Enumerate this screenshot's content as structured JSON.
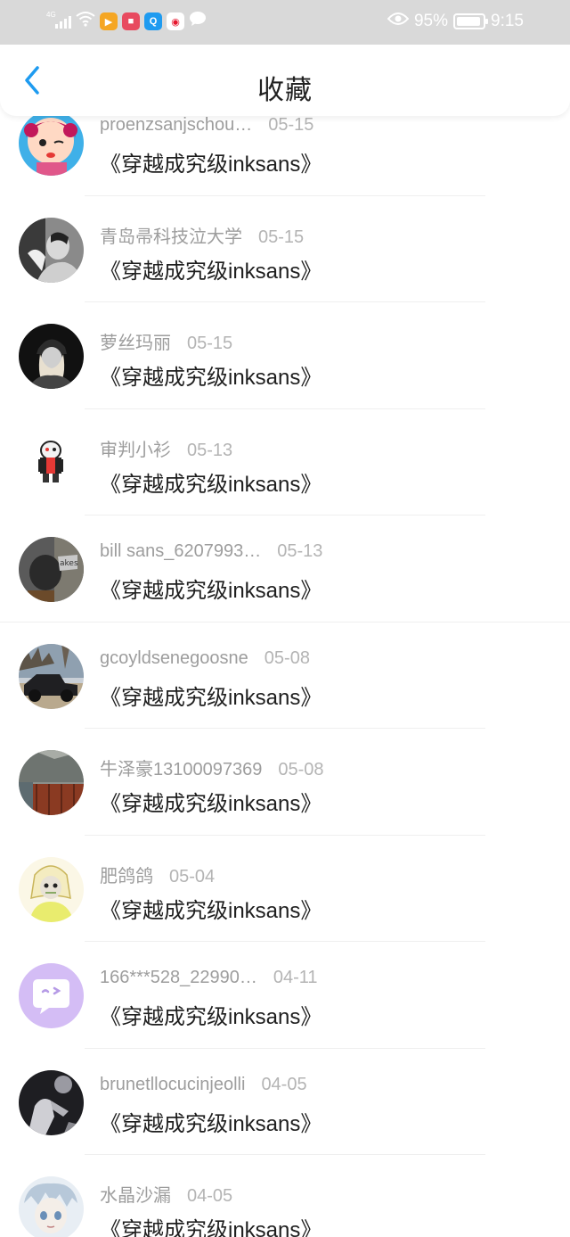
{
  "status_bar": {
    "network": "4G",
    "battery": "95%",
    "time": "9:15",
    "app_icons": [
      {
        "name": "video-app-icon",
        "color": "#f5a623",
        "glyph": "▶"
      },
      {
        "name": "reader-app-icon",
        "color": "#e84a5f",
        "glyph": "■"
      },
      {
        "name": "search-app-icon",
        "color": "#1e9bf0",
        "glyph": "Q"
      },
      {
        "name": "weibo-app-icon",
        "color": "#ffffff",
        "glyph": "◉"
      }
    ]
  },
  "nav": {
    "title": "收藏",
    "back_icon": "chevron-left-icon",
    "accent": "#1e9bf0"
  },
  "items": [
    {
      "user": "proenzsanjschou…",
      "date": "05-15",
      "title": "《穿越成究级inksans》"
    },
    {
      "user": "青岛帚科技泣大学",
      "date": "05-15",
      "title": "《穿越成究级inksans》"
    },
    {
      "user": "萝丝玛丽",
      "date": "05-15",
      "title": "《穿越成究级inksans》"
    },
    {
      "user": "审判小衫",
      "date": "05-13",
      "title": "《穿越成究级inksans》"
    },
    {
      "user": "bill sans_6207993…",
      "date": "05-13",
      "title": "《穿越成究级inksans》"
    },
    {
      "user": "gcoyldsenegoosne",
      "date": "05-08",
      "title": "《穿越成究级inksans》"
    },
    {
      "user": "牛泽豪13100097369",
      "date": "05-08",
      "title": "《穿越成究级inksans》"
    },
    {
      "user": "肥鸽鸽",
      "date": "05-04",
      "title": "《穿越成究级inksans》"
    },
    {
      "user": "166***528_22990…",
      "date": "04-11",
      "title": "《穿越成究级inksans》"
    },
    {
      "user": "brunetllocucinjeolli",
      "date": "04-05",
      "title": "《穿越成究级inksans》"
    },
    {
      "user": "水晶沙漏",
      "date": "04-05",
      "title": "《穿越成究级inksans》"
    }
  ]
}
